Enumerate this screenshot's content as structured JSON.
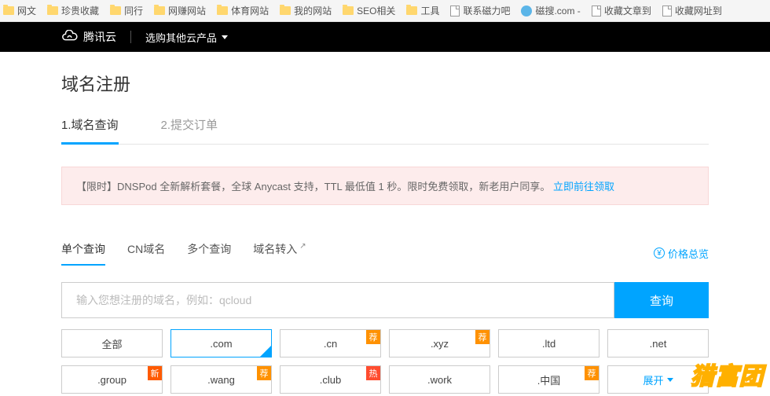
{
  "bookmarks": [
    {
      "type": "folder",
      "label": "网文"
    },
    {
      "type": "folder",
      "label": "珍贵收藏"
    },
    {
      "type": "folder",
      "label": "同行"
    },
    {
      "type": "folder",
      "label": "网赚网站"
    },
    {
      "type": "folder",
      "label": "体育网站"
    },
    {
      "type": "folder",
      "label": "我的网站"
    },
    {
      "type": "folder",
      "label": "SEO相关"
    },
    {
      "type": "folder",
      "label": "工具"
    },
    {
      "type": "page",
      "label": "联系磁力吧"
    },
    {
      "type": "custom",
      "label": "磁搜.com - "
    },
    {
      "type": "page",
      "label": "收藏文章到"
    },
    {
      "type": "page",
      "label": "收藏网址到"
    }
  ],
  "topnav": {
    "brand": "腾讯云",
    "menu1": "选购其他云产品"
  },
  "page_title": "域名注册",
  "steps": [
    {
      "label": "1.域名查询",
      "active": true
    },
    {
      "label": "2.提交订单",
      "active": false
    }
  ],
  "notice": {
    "text": "【限时】DNSPod 全新解析套餐，全球 Anycast 支持，TTL 最低值 1 秒。限时免费领取，新老用户同享。",
    "link_text": "立即前往领取"
  },
  "query_tabs": [
    {
      "label": "单个查询",
      "active": true
    },
    {
      "label": "CN域名"
    },
    {
      "label": "多个查询"
    },
    {
      "label": "域名转入",
      "ext": true
    }
  ],
  "price_link_label": "价格总览",
  "search": {
    "placeholder": "输入您想注册的域名，例如：qcloud",
    "button": "查询"
  },
  "tlds": [
    {
      "label": "全部"
    },
    {
      "label": ".com",
      "selected": true
    },
    {
      "label": ".cn",
      "badge": "荐",
      "badge_cls": "badge-rec"
    },
    {
      "label": ".xyz",
      "badge": "荐",
      "badge_cls": "badge-rec"
    },
    {
      "label": ".ltd"
    },
    {
      "label": ".net"
    },
    {
      "label": ".group",
      "badge": "新",
      "badge_cls": "badge-new"
    },
    {
      "label": ".wang",
      "badge": "荐",
      "badge_cls": "badge-rec"
    },
    {
      "label": ".club",
      "badge": "热",
      "badge_cls": "badge-hot"
    },
    {
      "label": ".work"
    },
    {
      "label": ".中国",
      "badge": "荐",
      "badge_cls": "badge-rec"
    }
  ],
  "expand_label": "展开",
  "watermark": "猎富团"
}
